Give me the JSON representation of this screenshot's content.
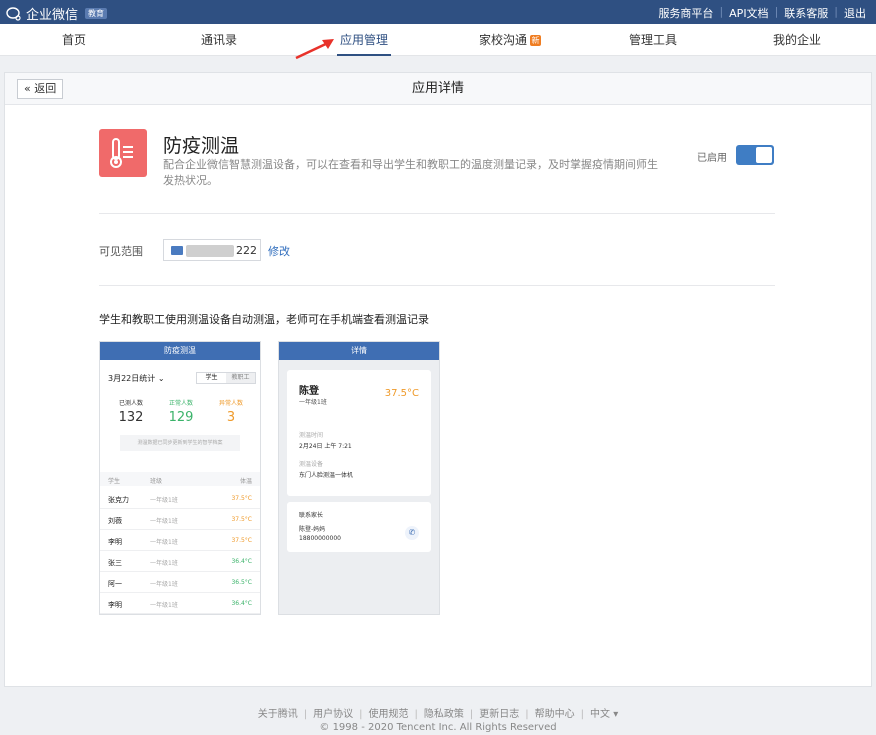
{
  "topbar": {
    "logo_text": "企业微信",
    "edu_badge": "教育",
    "links": [
      "服务商平台",
      "API文档",
      "联系客服",
      "退出"
    ]
  },
  "nav": {
    "items": [
      "首页",
      "通讯录",
      "应用管理",
      "家校沟通",
      "管理工具",
      "我的企业"
    ],
    "active": "应用管理",
    "new_badge": "新"
  },
  "page": {
    "back_label": "返回",
    "title": "应用详情"
  },
  "app": {
    "name": "防疫测温",
    "description": "配合企业微信智慧测温设备，可以在查看和导出学生和教职工的温度测量记录，及时掌握疫情期间师生发热状况。",
    "status_label": "已启用",
    "enabled": true,
    "icon": "thermometer-icon",
    "icon_color": "#f06a6a"
  },
  "scope": {
    "label": "可见范围",
    "value_suffix": "222",
    "modify_label": "修改"
  },
  "feature_text": "学生和教职工使用测温设备自动测温，老师可在手机端查看测温记录",
  "phone1": {
    "title": "防疫测温",
    "date_label": "3月22日统计",
    "tabs": [
      "学生",
      "教职工"
    ],
    "stats": [
      {
        "label": "已测人数",
        "value": "132",
        "color": "#333333"
      },
      {
        "label": "正常人数",
        "value": "129",
        "color": "#3bb36a"
      },
      {
        "label": "异常人数",
        "value": "3",
        "color": "#ef9a2a"
      }
    ],
    "hint": "测温数据已同步更新到学生的智学档案",
    "headers": [
      "学生",
      "班级",
      "体温"
    ],
    "rows": [
      {
        "name": "张克力",
        "class": "一年级1班",
        "temp": "37.5°C",
        "color": "#ef9a2a"
      },
      {
        "name": "刘薇",
        "class": "一年级1班",
        "temp": "37.5°C",
        "color": "#ef9a2a"
      },
      {
        "name": "李明",
        "class": "一年级1班",
        "temp": "37.5°C",
        "color": "#ef9a2a"
      },
      {
        "name": "张三",
        "class": "一年级1班",
        "temp": "36.4°C",
        "color": "#3bb36a"
      },
      {
        "name": "阿一",
        "class": "一年级1班",
        "temp": "36.5°C",
        "color": "#3bb36a"
      },
      {
        "name": "李明",
        "class": "一年级1班",
        "temp": "36.4°C",
        "color": "#3bb36a"
      }
    ]
  },
  "phone2": {
    "title": "详情",
    "name": "陈登",
    "class": "一年级1班",
    "temp": "37.5°C",
    "time_label": "测温时间",
    "time_value": "2月24日 上午 7:21",
    "device_label": "测温设备",
    "device_value": "东门人脸测温一体机",
    "contact_title": "联系家长",
    "contact_name": "陈登-妈妈",
    "contact_phone": "18800000000"
  },
  "footer": {
    "links": [
      "关于腾讯",
      "用户协议",
      "使用规范",
      "隐私政策",
      "更新日志",
      "帮助中心",
      "中文 ▾"
    ],
    "copyright": "© 1998 - 2020 Tencent Inc. All Rights Reserved"
  }
}
